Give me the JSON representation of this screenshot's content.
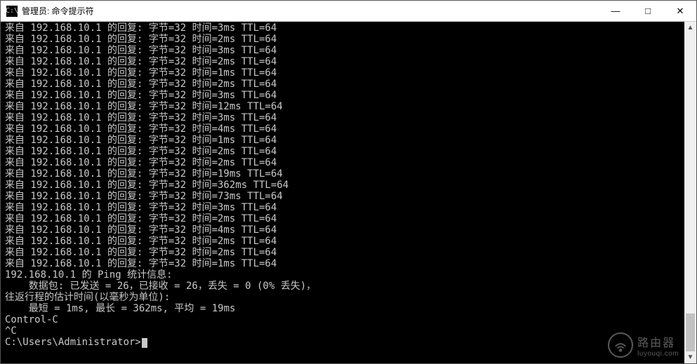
{
  "window": {
    "icon_glyph": "C:\\",
    "title": "管理员: 命令提示符"
  },
  "controls": {
    "minimize": "—",
    "maximize": "□",
    "close": "✕"
  },
  "ping": {
    "host": "192.168.10.1",
    "bytes": 32,
    "ttl": 64,
    "reply_prefix": "来自 ",
    "reply_mid": " 的回复: 字节=",
    "reply_time": " 时间=",
    "reply_ttl": " TTL=",
    "times_ms": [
      3,
      2,
      3,
      2,
      1,
      2,
      3,
      12,
      3,
      4,
      1,
      2,
      2,
      19,
      362,
      73,
      3,
      2,
      4,
      2,
      2,
      1
    ]
  },
  "stats": {
    "header_prefix": "",
    "header_label": " 的 Ping 统计信息:",
    "packets_label": "    数据包: 已发送 = ",
    "sent": 26,
    "recv_label": "，已接收 = ",
    "recv": 26,
    "lost_label": "，丢失 = ",
    "lost": 0,
    "lost_pct_label": " (0% 丢失)，",
    "rtt_header": "往返行程的估计时间(以毫秒为单位):",
    "rtt_min_label": "    最短 = ",
    "rtt_min": "1ms",
    "rtt_max_label": ", 最长 = ",
    "rtt_max": "362ms",
    "rtt_avg_label": ", 平均 = ",
    "rtt_avg": "19ms"
  },
  "ctrl_c": "Control-C",
  "caret": "^C",
  "prompt": "C:\\Users\\Administrator>",
  "watermark": {
    "cn": "路由器",
    "en": "luyouqi.com"
  }
}
